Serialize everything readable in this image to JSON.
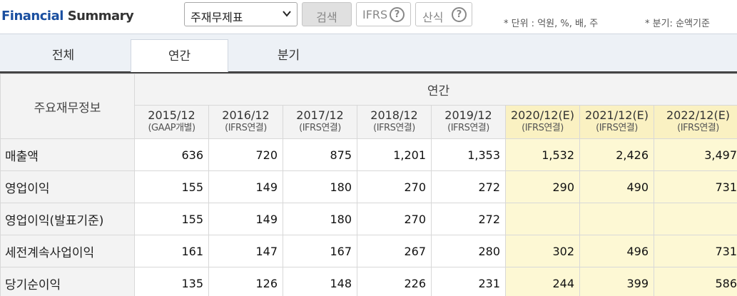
{
  "header": {
    "title_part1": "Financial",
    "title_part2": "Summary",
    "report_select": "주재무제표",
    "search_button": "검색",
    "ifrs_button": "IFRS",
    "calc_button": "산식",
    "unit_note": "* 단위 : 억원, %, 배, 주",
    "quarter_note": "* 분기: 순액기준"
  },
  "tabs": [
    {
      "label": "전체",
      "active": false
    },
    {
      "label": "연간",
      "active": true
    },
    {
      "label": "분기",
      "active": false
    }
  ],
  "table": {
    "corner_label": "주요재무정보",
    "group_label": "연간",
    "columns": [
      {
        "date": "2015/12",
        "basis": "(GAAP개별)",
        "estimate": false
      },
      {
        "date": "2016/12",
        "basis": "(IFRS연결)",
        "estimate": false
      },
      {
        "date": "2017/12",
        "basis": "(IFRS연결)",
        "estimate": false
      },
      {
        "date": "2018/12",
        "basis": "(IFRS연결)",
        "estimate": false
      },
      {
        "date": "2019/12",
        "basis": "(IFRS연결)",
        "estimate": false
      },
      {
        "date": "2020/12(E)",
        "basis": "(IFRS연결)",
        "estimate": true
      },
      {
        "date": "2021/12(E)",
        "basis": "(IFRS연결)",
        "estimate": true
      },
      {
        "date": "2022/12(E)",
        "basis": "(IFRS연결)",
        "estimate": true
      }
    ],
    "rows": [
      {
        "label": "매출액",
        "values": [
          "636",
          "720",
          "875",
          "1,201",
          "1,353",
          "1,532",
          "2,426",
          "3,497"
        ]
      },
      {
        "label": "영업이익",
        "values": [
          "155",
          "149",
          "180",
          "270",
          "272",
          "290",
          "490",
          "731"
        ]
      },
      {
        "label": "영업이익(발표기준)",
        "values": [
          "155",
          "149",
          "180",
          "270",
          "272",
          "",
          "",
          ""
        ]
      },
      {
        "label": "세전계속사업이익",
        "values": [
          "161",
          "147",
          "167",
          "267",
          "280",
          "302",
          "496",
          "731"
        ]
      },
      {
        "label": "당기순이익",
        "values": [
          "135",
          "126",
          "148",
          "226",
          "231",
          "244",
          "399",
          "586"
        ]
      }
    ]
  },
  "colors": {
    "brand": "#1a4fa0",
    "estimate_bg": "#fdf8d4"
  },
  "icons": {
    "select_chevron": "chevron-down-icon",
    "help": "question-circle-icon"
  }
}
